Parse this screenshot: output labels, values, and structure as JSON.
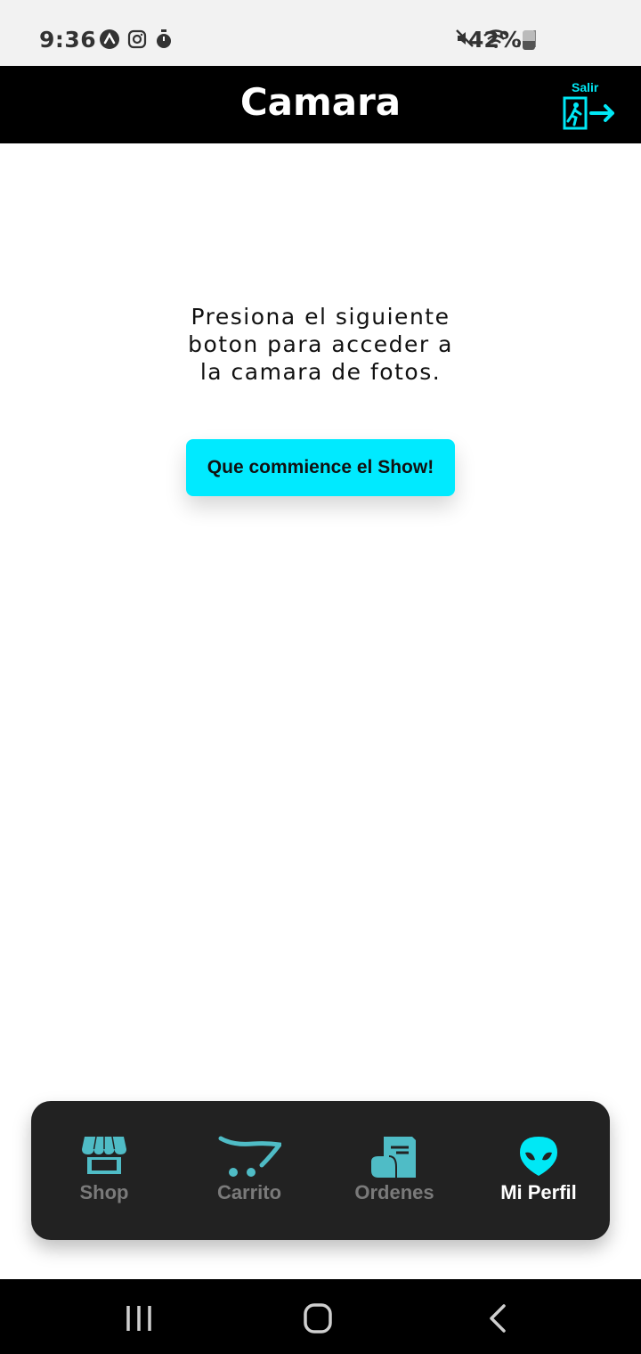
{
  "status_bar": {
    "time": "9:36",
    "battery": "42%",
    "icons_left": [
      "app-icon",
      "instagram-icon",
      "timer-icon"
    ],
    "icons_right": [
      "mute-icon",
      "wifi-icon",
      "signal-icon"
    ]
  },
  "header": {
    "title": "Camara",
    "exit_label": "Salir",
    "accent_color": "#00e8f5"
  },
  "main": {
    "message_lines": [
      "Presiona el siguiente",
      "boton para acceder a",
      "la camara de fotos."
    ],
    "button_label": "Que commience el Show!",
    "button_color": "#00eaff"
  },
  "bottom_nav": {
    "items": [
      {
        "label": "Shop",
        "icon": "store-icon",
        "active": false
      },
      {
        "label": "Carrito",
        "icon": "cart-icon",
        "active": false
      },
      {
        "label": "Ordenes",
        "icon": "receipt-icon",
        "active": false
      },
      {
        "label": "Mi Perfil",
        "icon": "alien-icon",
        "active": true
      }
    ],
    "icon_color": "#4fbcc6",
    "active_icon_color": "#00e8f5"
  },
  "system_nav": {
    "buttons": [
      "recent-apps",
      "home",
      "back"
    ]
  }
}
